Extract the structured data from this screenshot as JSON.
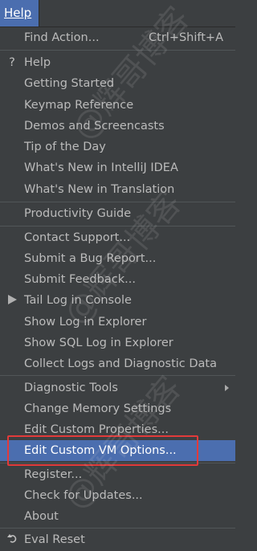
{
  "menubar": {
    "help": "Help"
  },
  "menu": {
    "find_action": {
      "label": "Find Action...",
      "shortcut": "Ctrl+Shift+A"
    },
    "help": "Help",
    "getting_started": "Getting Started",
    "keymap_reference": "Keymap Reference",
    "demos": "Demos and Screencasts",
    "tip_of_day": "Tip of the Day",
    "whats_new_idea": "What's New in IntelliJ IDEA",
    "whats_new_translation": "What's New in Translation",
    "productivity_guide": "Productivity Guide",
    "contact_support": "Contact Support...",
    "submit_bug": "Submit a Bug Report...",
    "submit_feedback": "Submit Feedback...",
    "tail_log": "Tail Log in Console",
    "show_log": "Show Log in Explorer",
    "show_sql_log": "Show SQL Log in Explorer",
    "collect_logs": "Collect Logs and Diagnostic Data",
    "diagnostic_tools": "Diagnostic Tools",
    "change_memory": "Change Memory Settings",
    "edit_props": "Edit Custom Properties...",
    "edit_vm": "Edit Custom VM Options...",
    "register": "Register...",
    "check_updates": "Check for Updates...",
    "about": "About",
    "eval_reset": "Eval Reset"
  },
  "icons": {
    "help": "question-mark-icon",
    "tail_log": "play-icon",
    "eval_reset": "undo-icon"
  },
  "watermark": "@辉哥博客",
  "colors": {
    "selection": "#4b6eaf",
    "highlight_box": "#e23a3a",
    "background": "#3c3f41"
  }
}
